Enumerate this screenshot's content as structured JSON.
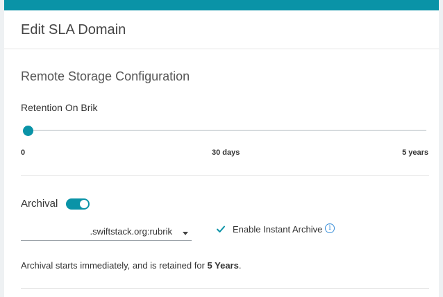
{
  "header": {
    "title": "Edit SLA Domain"
  },
  "section": {
    "title": "Remote Storage Configuration"
  },
  "retention": {
    "label": "Retention On Brik",
    "slider_value_fraction": 0.0,
    "ticks": [
      "0",
      "30 days",
      "5 years"
    ]
  },
  "archival": {
    "label": "Archival",
    "toggle_on": true,
    "location_value": ".swiftstack.org:rubrik",
    "instant_archive_label": "Enable Instant Archive",
    "instant_archive_checked": true,
    "info_icon": "info-icon",
    "description_prefix": "Archival starts immediately, and is retained for ",
    "description_emphasis": "5 Years",
    "description_suffix": "."
  },
  "colors": {
    "accent": "#0a93a7",
    "info": "#3b8fd9",
    "border": "#e5e5e5"
  }
}
